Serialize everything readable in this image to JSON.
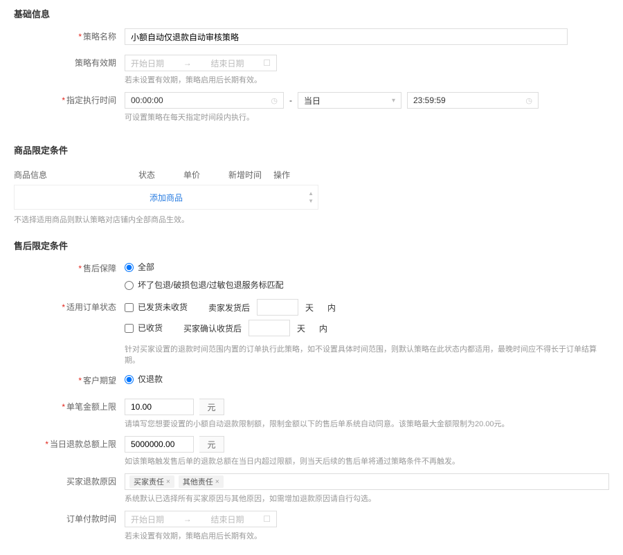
{
  "sections": {
    "basic": "基础信息",
    "product": "商品限定条件",
    "after_sale": "售后限定条件"
  },
  "basic": {
    "strategy_name": {
      "label": "策略名称",
      "value": "小额自动仅退款自动审核策略"
    },
    "validity": {
      "label": "策略有效期",
      "start_ph": "开始日期",
      "end_ph": "结束日期",
      "hint": "若未设置有效期，策略启用后长期有效。"
    },
    "exec_time": {
      "label": "指定执行时间",
      "start": "00:00:00",
      "day": "当日",
      "end": "23:59:59",
      "hint": "可设置策略在每天指定时间段内执行。"
    }
  },
  "product": {
    "cols": {
      "info": "商品信息",
      "status": "状态",
      "price": "单价",
      "time": "新增时间",
      "op": "操作"
    },
    "add": "添加商品",
    "hint": "不选择适用商品则默认策略对店铺内全部商品生效。"
  },
  "after_sale": {
    "guarantee": {
      "label": "售后保障",
      "opt_all": "全部",
      "opt_match": "坏了包退/破损包退/过敏包退服务标匹配"
    },
    "order_status": {
      "label": "适用订单状态",
      "chk_shipped": "已发货未收货",
      "lbl_ship_after": "卖家发货后",
      "unit_day": "天",
      "txt_within": "内",
      "chk_received": "已收货",
      "lbl_confirm_after": "买家确认收货后",
      "hint": "针对买家设置的退款时间范围内置的订单执行此策略，如不设置具体时间范围，则默认策略在此状态内都适用，最晚时间应不得长于订单结算期。"
    },
    "customer_expect": {
      "label": "客户期望",
      "opt_refund_only": "仅退款"
    },
    "single_amount": {
      "label": "单笔金额上限",
      "value": "10.00",
      "unit": "元",
      "hint": "请填写您想要设置的小额自动退款限制额，限制金额以下的售后单系统自动同意。该策略最大金额限制为20.00元。"
    },
    "daily_total": {
      "label": "当日退款总额上限",
      "value": "5000000.00",
      "unit": "元",
      "hint": "如该策略触发售后单的退款总额在当日内超过限额，则当天后续的售后单将通过策略条件不再触发。"
    },
    "refund_reason": {
      "label": "买家退款原因",
      "tags": [
        "买家责任",
        "其他责任"
      ],
      "hint": "系统默认已选择所有买家原因与其他原因，如需增加退款原因请自行勾选。"
    },
    "pay_time": {
      "label": "订单付款时间",
      "start_ph": "开始日期",
      "end_ph": "结束日期",
      "hint": "若未设置有效期，策略启用后长期有效。"
    }
  }
}
